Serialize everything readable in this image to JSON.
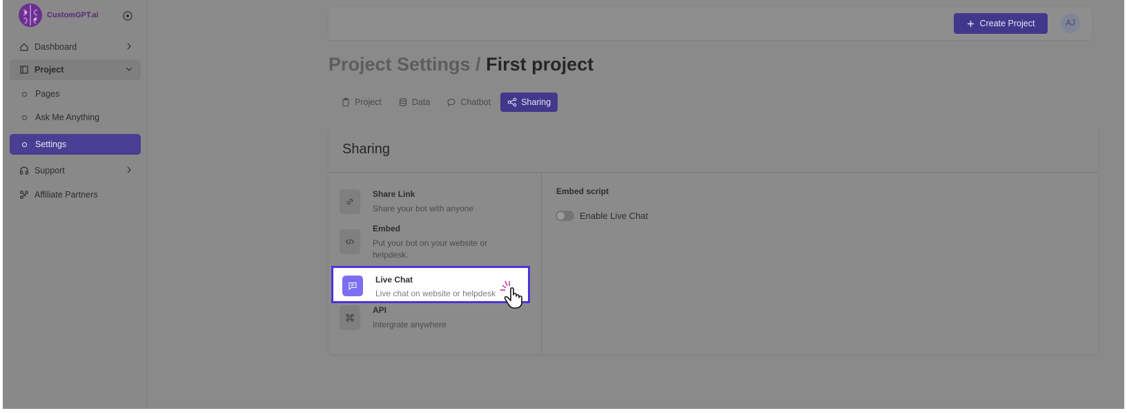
{
  "brand": {
    "name": "CustomGPT.ai"
  },
  "sidebar": {
    "items": [
      {
        "label": "Dashboard",
        "icon": "home-icon"
      },
      {
        "label": "Project",
        "icon": "project-icon"
      },
      {
        "label": "Pages",
        "icon": "dot-icon"
      },
      {
        "label": "Ask Me Anything",
        "icon": "dot-icon"
      },
      {
        "label": "Settings",
        "icon": "dot-icon"
      },
      {
        "label": "Support",
        "icon": "headset-icon"
      },
      {
        "label": "Affiliate Partners",
        "icon": "affiliate-icon"
      }
    ]
  },
  "header": {
    "create_label": "Create Project",
    "avatar": "AJ"
  },
  "page": {
    "title_prefix": "Project Settings /",
    "title_main": "First project"
  },
  "tabs": [
    {
      "label": "Project",
      "icon": "clipboard-icon"
    },
    {
      "label": "Data",
      "icon": "database-icon"
    },
    {
      "label": "Chatbot",
      "icon": "chat-icon"
    },
    {
      "label": "Sharing",
      "icon": "share-icon"
    }
  ],
  "sharing": {
    "title": "Sharing",
    "items": [
      {
        "title": "Share Link",
        "desc": "Share your bot with anyone",
        "icon": "link-icon"
      },
      {
        "title": "Embed",
        "desc": "Put your bot on your website or helpdesk.",
        "icon": "code-icon"
      },
      {
        "title": "Live Chat",
        "desc": "Live chat on website or helpdesk",
        "icon": "message-icon"
      },
      {
        "title": "API",
        "desc": "Intergrate anywhere",
        "icon": "command-icon"
      }
    ],
    "embed_label": "Embed script",
    "toggle_label": "Enable Live Chat",
    "toggle_on": false
  },
  "colors": {
    "accent": "#43378c",
    "highlight_border": "#4a34d8",
    "overlay": "#8a8a8a"
  }
}
